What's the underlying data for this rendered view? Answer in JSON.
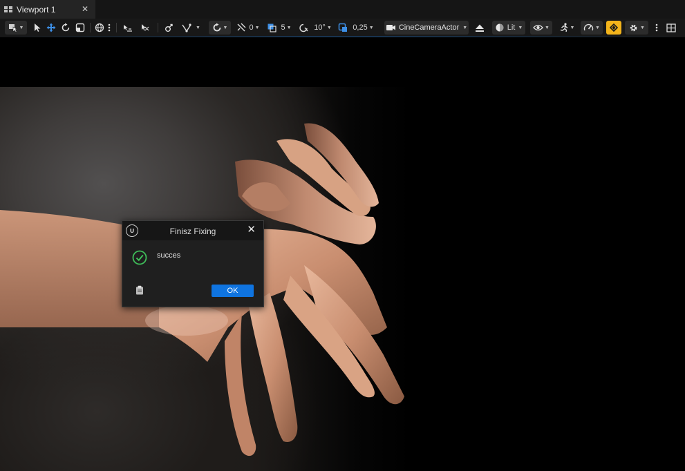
{
  "tab": {
    "label": "Viewport 1",
    "close": "✕"
  },
  "toolbar": {
    "snap_translate_value": "0",
    "grid_size_value": "5",
    "rotation_snap_value": "10°",
    "scale_snap_value": "0,25",
    "camera_label": "CineCameraActor",
    "view_mode_label": "Lit"
  },
  "dialog": {
    "title": "Finisz Fixing",
    "close": "✕",
    "logo_text": "U",
    "message": "succes",
    "ok_label": "OK"
  },
  "colors": {
    "accent_blue": "#0f74e0",
    "toggle_yellow": "#f3b41b",
    "success_green": "#3fbf5a"
  }
}
